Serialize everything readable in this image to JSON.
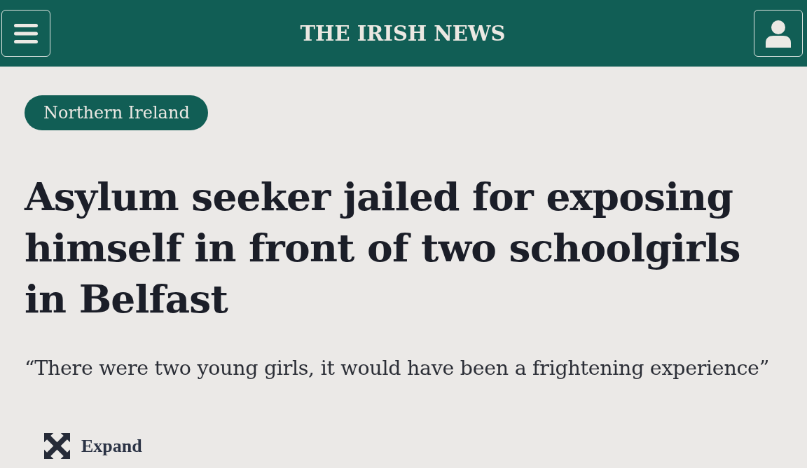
{
  "header": {
    "title": "THE IRISH NEWS"
  },
  "article": {
    "section_tag": "Northern Ireland",
    "headline": "Asylum seeker jailed for exposing himself in front of two schoolgirls in Belfast",
    "standfirst": "“There were two young girls, it would have been a frightening experience”",
    "expand": {
      "label": "Expand"
    }
  }
}
